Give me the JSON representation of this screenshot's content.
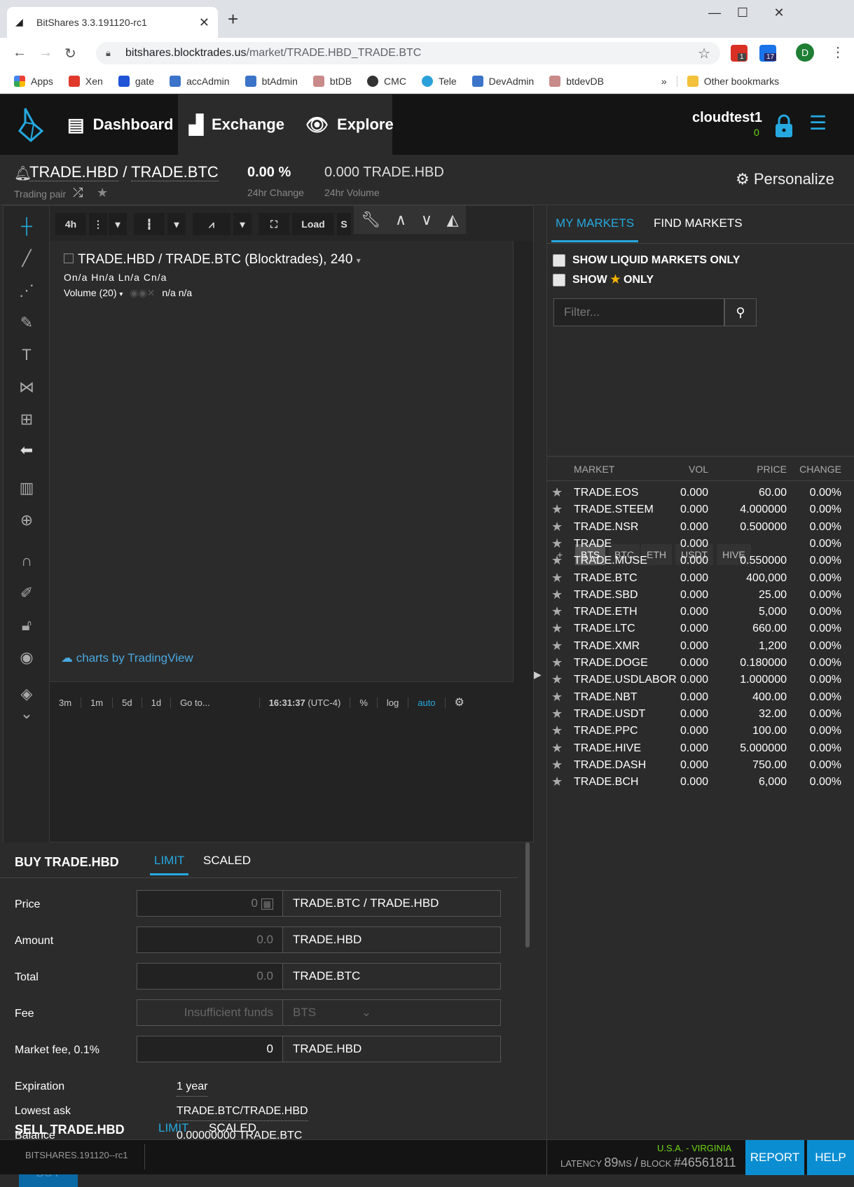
{
  "browser": {
    "tab_title": "BitShares 3.3.191120-rc1",
    "url_domain": "bitshares.blocktrades.us",
    "url_path": "/market/TRADE.HBD_TRADE.BTC",
    "profile_initial": "D",
    "ext1_badge": "1",
    "ext2_badge": "17",
    "bookmarks": [
      "Apps",
      "Xen",
      "gate",
      "accAdmin",
      "btAdmin",
      "btDB",
      "CMC",
      "Tele",
      "DevAdmin",
      "btdevDB"
    ],
    "bookmarks_more": "»",
    "other_bookmarks": "Other bookmarks"
  },
  "nav": {
    "dashboard": "Dashboard",
    "exchange": "Exchange",
    "explore": "Explore",
    "account": "cloudtest1",
    "account_balance": "0"
  },
  "pair": {
    "base": "TRADE.HBD",
    "sep": "/",
    "quote": "TRADE.BTC",
    "sub": "Trading pair",
    "change": "0.00 %",
    "change_label": "24hr Change",
    "volume": "0.000 TRADE.HBD",
    "volume_label": "24hr Volume",
    "personalize": "Personalize"
  },
  "chart": {
    "interval": "4h",
    "load": "Load",
    "save_partial": "S",
    "title": "TRADE.HBD / TRADE.BTC (Blocktrades), 240",
    "ohlc": "On/a Hn/a Ln/a Cn/a",
    "volume": "Volume (20)",
    "volume_vals": "n/a n/a",
    "attribution": "charts by TradingView",
    "ranges": [
      "3m",
      "1m",
      "5d",
      "1d",
      "Go to..."
    ],
    "time": "16:31:37",
    "tz": "(UTC-4)",
    "pct": "%",
    "log": "log",
    "auto": "auto"
  },
  "buy": {
    "title": "BUY TRADE.HBD",
    "tab_limit": "LIMIT",
    "tab_scaled": "SCALED",
    "price_label": "Price",
    "price_placeholder": "0",
    "price_unit": "TRADE.BTC / TRADE.HBD",
    "amount_label": "Amount",
    "amount_placeholder": "0.0",
    "amount_unit": "TRADE.HBD",
    "total_label": "Total",
    "total_placeholder": "0.0",
    "total_unit": "TRADE.BTC",
    "fee_label": "Fee",
    "fee_value": "Insufficient funds",
    "fee_unit": "BTS",
    "mfee_label": "Market fee, 0.1%",
    "mfee_value": "0",
    "mfee_unit": "TRADE.HBD",
    "exp_label": "Expiration",
    "exp_value": "1 year",
    "ask_label": "Lowest ask",
    "ask_value": "TRADE.BTC/TRADE.HBD",
    "bal_label": "Balance",
    "bal_value": "0.00000000 TRADE.BTC",
    "button": "BUY"
  },
  "sell": {
    "title": "SELL TRADE.HBD",
    "tab_limit": "LIMIT",
    "tab_scaled": "SCALED"
  },
  "markets": {
    "tab_my": "MY MARKETS",
    "tab_find": "FIND MARKETS",
    "liquid_only": "SHOW LIQUID MARKETS ONLY",
    "show_star_a": "SHOW",
    "show_star_b": "ONLY",
    "filter_placeholder": "Filter...",
    "quote_tabs": [
      "+",
      "BTS",
      "BTC",
      "ETH",
      "USDT",
      "HIVE"
    ],
    "headers": {
      "market": "MARKET",
      "vol": "VOL",
      "price": "PRICE",
      "change": "CHANGE"
    },
    "rows": [
      {
        "name": "TRADE.EOS",
        "vol": "0.000",
        "price": "60.00",
        "change": "0.00%"
      },
      {
        "name": "TRADE.STEEM",
        "vol": "0.000",
        "price": "4.000000",
        "change": "0.00%"
      },
      {
        "name": "TRADE.NSR",
        "vol": "0.000",
        "price": "0.500000",
        "change": "0.00%"
      },
      {
        "name": "TRADE",
        "vol": "0.000",
        "price": "",
        "change": "0.00%"
      },
      {
        "name": "TRADE.MUSE",
        "vol": "0.000",
        "price": "0.550000",
        "change": "0.00%"
      },
      {
        "name": "TRADE.BTC",
        "vol": "0.000",
        "price": "400,000",
        "change": "0.00%"
      },
      {
        "name": "TRADE.SBD",
        "vol": "0.000",
        "price": "25.00",
        "change": "0.00%"
      },
      {
        "name": "TRADE.ETH",
        "vol": "0.000",
        "price": "5,000",
        "change": "0.00%"
      },
      {
        "name": "TRADE.LTC",
        "vol": "0.000",
        "price": "660.00",
        "change": "0.00%"
      },
      {
        "name": "TRADE.XMR",
        "vol": "0.000",
        "price": "1,200",
        "change": "0.00%"
      },
      {
        "name": "TRADE.DOGE",
        "vol": "0.000",
        "price": "0.180000",
        "change": "0.00%"
      },
      {
        "name": "TRADE.USDLABOR",
        "vol": "0.000",
        "price": "1.000000",
        "change": "0.00%"
      },
      {
        "name": "TRADE.NBT",
        "vol": "0.000",
        "price": "400.00",
        "change": "0.00%"
      },
      {
        "name": "TRADE.USDT",
        "vol": "0.000",
        "price": "32.00",
        "change": "0.00%"
      },
      {
        "name": "TRADE.PPC",
        "vol": "0.000",
        "price": "100.00",
        "change": "0.00%"
      },
      {
        "name": "TRADE.HIVE",
        "vol": "0.000",
        "price": "5.000000",
        "change": "0.00%"
      },
      {
        "name": "TRADE.DASH",
        "vol": "0.000",
        "price": "750.00",
        "change": "0.00%"
      },
      {
        "name": "TRADE.BCH",
        "vol": "0.000",
        "price": "6,000",
        "change": "0.00%"
      }
    ]
  },
  "footer": {
    "version": "BITSHARES.191120--rc1",
    "location": "U.S.A. - VIRGINIA",
    "latency_label": "LATENCY",
    "latency": "89",
    "latency_unit": "MS",
    "block_label": "BLOCK",
    "block": "#46561811",
    "report": "REPORT",
    "help": "HELP"
  },
  "colors": {
    "accent": "#00a9e0",
    "green": "#6fd615",
    "button_blue": "#0b69a6",
    "star_gold": "#f5b400"
  }
}
